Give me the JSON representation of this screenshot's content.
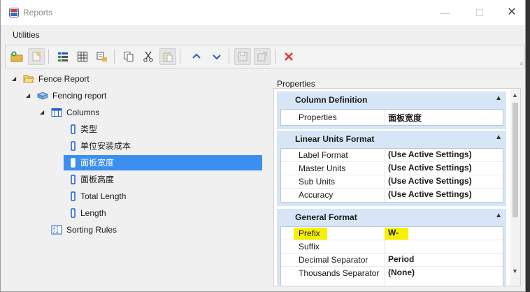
{
  "window": {
    "title": "Reports",
    "min_glyph": "—",
    "max_glyph": "☐",
    "close_glyph": "✕"
  },
  "menu": {
    "items": [
      "Utilities"
    ]
  },
  "toolbar": {
    "buttons": [
      {
        "name": "new-report-folder-icon",
        "disabled": false
      },
      {
        "name": "new-report-icon",
        "disabled": true
      },
      {
        "name": "add-columns-icon",
        "disabled": false
      },
      {
        "name": "table-icon",
        "disabled": false
      },
      {
        "name": "sorting-rules-icon",
        "disabled": false
      },
      {
        "name": "copy-icon",
        "disabled": false
      },
      {
        "name": "cut-icon",
        "disabled": false
      },
      {
        "name": "paste-icon",
        "disabled": true
      },
      {
        "name": "move-up-icon",
        "disabled": false
      },
      {
        "name": "move-down-icon",
        "disabled": false
      },
      {
        "name": "save-icon",
        "disabled": true
      },
      {
        "name": "save-as-icon",
        "disabled": true
      },
      {
        "name": "delete-icon",
        "disabled": false
      }
    ],
    "overflow_glyph": "≡"
  },
  "tree": {
    "root": {
      "label": "Fence Report",
      "expanded": true
    },
    "report": {
      "label": "Fencing report",
      "expanded": true
    },
    "columns": {
      "label": "Columns",
      "expanded": true
    },
    "column_items": [
      {
        "label": "类型",
        "selected": false
      },
      {
        "label": "单位安装成本",
        "selected": false
      },
      {
        "label": "面板宽度",
        "selected": true
      },
      {
        "label": "面板高度",
        "selected": false
      },
      {
        "label": "Total Length",
        "selected": false
      },
      {
        "label": "Length",
        "selected": false
      }
    ],
    "sorting": {
      "label": "Sorting Rules"
    }
  },
  "properties": {
    "header": "Properties",
    "sections": [
      {
        "title": "Column Definition",
        "rows": [
          {
            "name": "Properties",
            "value": "面板宽度"
          }
        ]
      },
      {
        "title": "Linear Units Format",
        "rows": [
          {
            "name": "Label Format",
            "value": "(Use Active Settings)"
          },
          {
            "name": "Master Units",
            "value": "(Use Active Settings)"
          },
          {
            "name": "Sub Units",
            "value": "(Use Active Settings)"
          },
          {
            "name": "Accuracy",
            "value": "(Use Active Settings)"
          }
        ]
      },
      {
        "title": "General Format",
        "rows": [
          {
            "name": "Prefix",
            "value": "W-",
            "highlight": true
          },
          {
            "name": "Suffix",
            "value": ""
          },
          {
            "name": "Decimal Separator",
            "value": "Period"
          },
          {
            "name": "Thousands Separator",
            "value": "(None)"
          }
        ]
      }
    ]
  },
  "colors": {
    "selection": "#3b8ff0",
    "section_header": "#d6e6f6",
    "highlight": "#f7f000",
    "delete": "#e53935",
    "nav_arrow": "#1f5fbf"
  }
}
